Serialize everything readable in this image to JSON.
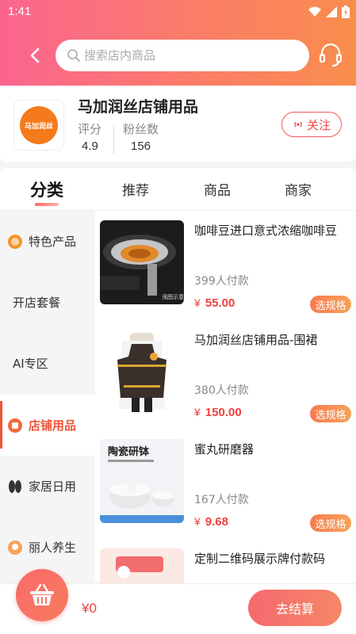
{
  "status_bar": {
    "time": "1:41"
  },
  "header": {
    "search_placeholder": "搜索店内商品"
  },
  "store": {
    "name": "马加润丝店铺用品",
    "logo_text": "马加润丝",
    "rating_label": "评分",
    "rating_value": "4.9",
    "fans_label": "粉丝数",
    "fans_value": "156",
    "follow_label": "关注"
  },
  "tabs": [
    {
      "label": "分类",
      "active": true
    },
    {
      "label": "推荐"
    },
    {
      "label": "商品"
    },
    {
      "label": "商家"
    }
  ],
  "sidebar": {
    "items": [
      {
        "label": "特色产品",
        "icon": "feature-badge-icon"
      },
      {
        "label": "开店套餐"
      },
      {
        "label": "AI专区"
      },
      {
        "label": "店铺用品",
        "icon": "shop-supplies-icon",
        "active": true
      },
      {
        "label": "家居日用",
        "icon": "slippers-icon"
      },
      {
        "label": "丽人养生",
        "icon": "beauty-icon"
      }
    ]
  },
  "products": [
    {
      "title": "咖啡豆进口意式浓缩咖啡豆",
      "sold": "399人付款",
      "currency": "¥",
      "price": "55.00",
      "spec_label": "选规格",
      "image_caption": "浅图示意"
    },
    {
      "title": "马加润丝店铺用品-围裙",
      "sold": "380人付款",
      "currency": "¥",
      "price": "150.00",
      "spec_label": "选规格"
    },
    {
      "title": "蜜丸研磨器",
      "sold": "167人付款",
      "currency": "¥",
      "price": "9.68",
      "spec_label": "选规格",
      "image_title": "陶瓷研钵"
    },
    {
      "title": "定制二维码展示牌付款码"
    }
  ],
  "bottom_bar": {
    "cart_total": "¥0",
    "checkout_label": "去结算"
  },
  "colors": {
    "header_start": "#fb6490",
    "header_end": "#f98d4c",
    "accent_red": "#f04040",
    "active_orange": "#f05536"
  }
}
